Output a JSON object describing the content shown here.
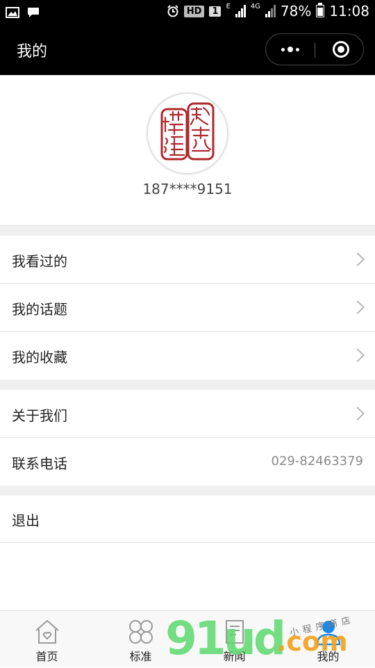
{
  "status_bar": {
    "hd": "HD",
    "sim": "1",
    "network_e": "E",
    "network_4g": "4G",
    "battery": "78%",
    "time": "11:08"
  },
  "nav": {
    "title": "我的"
  },
  "profile": {
    "phone": "187****9151",
    "avatar_seal_chars": "建築標準"
  },
  "menu_group_1": [
    {
      "label": "我看过的"
    },
    {
      "label": "我的话题"
    },
    {
      "label": "我的收藏"
    }
  ],
  "menu_group_2": {
    "about": {
      "label": "关于我们"
    },
    "contact": {
      "label": "联系电话",
      "value": "029-82463379"
    }
  },
  "menu_group_3": {
    "logout": {
      "label": "退出"
    }
  },
  "tabbar": [
    {
      "label": "首页",
      "icon": "home-icon"
    },
    {
      "label": "标准",
      "icon": "grid-icon"
    },
    {
      "label": "新闻",
      "icon": "document-icon"
    },
    {
      "label": "我的",
      "icon": "user-icon",
      "active": true
    }
  ],
  "watermark": {
    "brand": "91ud",
    "suffix": ".com",
    "small_text": "小程序商店"
  },
  "colors": {
    "header_bg": "#000000",
    "page_bg": "#f0f0f0",
    "seal_red": "#b0272d",
    "active_tab_blue": "#1e88e5"
  }
}
